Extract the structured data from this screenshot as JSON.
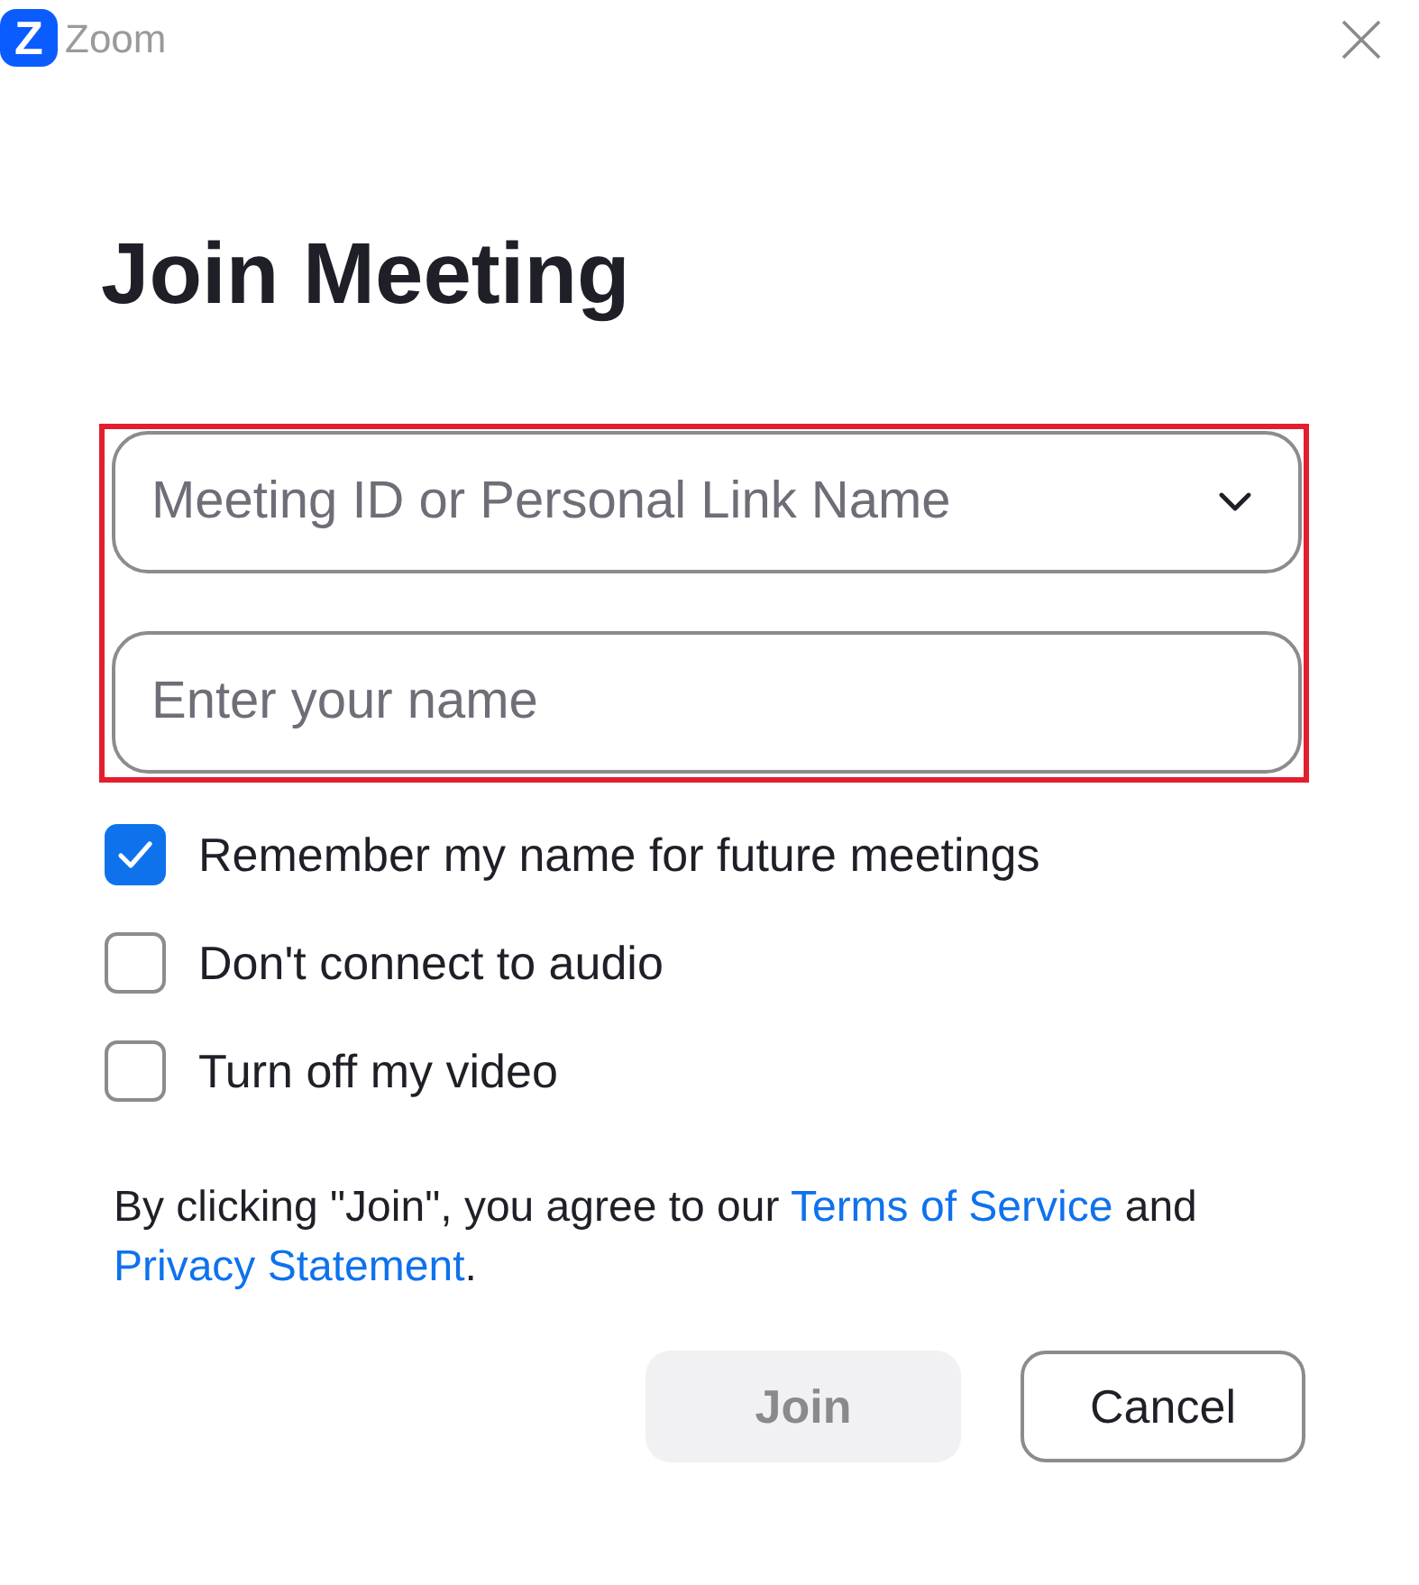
{
  "window": {
    "logo_letter": "Z",
    "app_name": "Zoom"
  },
  "heading": "Join Meeting",
  "form": {
    "highlighted": true,
    "fields": [
      {
        "kind": "dropdown",
        "placeholder": "Meeting ID or Personal Link Name"
      },
      {
        "kind": "text",
        "placeholder": "Enter your name"
      }
    ]
  },
  "options": [
    {
      "label": "Remember my name for future meetings",
      "checked": true
    },
    {
      "label": "Don't connect to audio",
      "checked": false
    },
    {
      "label": "Turn off my video",
      "checked": false
    }
  ],
  "agreement": [
    {
      "kind": "text",
      "text": "By clicking \"Join\", you agree to our "
    },
    {
      "kind": "link",
      "text": "Terms of Service"
    },
    {
      "kind": "text",
      "text": " and "
    },
    {
      "kind": "link",
      "text": "Privacy Statement"
    },
    {
      "kind": "text",
      "text": "."
    }
  ],
  "buttons": [
    {
      "label": "Join",
      "kind": "primary",
      "disabled": true
    },
    {
      "label": "Cancel",
      "kind": "secondary",
      "disabled": false
    }
  ]
}
